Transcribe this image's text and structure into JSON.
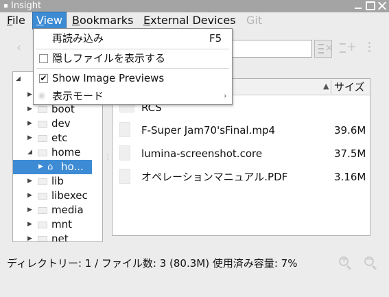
{
  "window": {
    "title": "Insight",
    "controls": {
      "minimize_icon": "minimize-icon",
      "maximize_icon": "maximize-icon",
      "close_icon": "close-icon"
    }
  },
  "menubar": {
    "file": {
      "prefix": "",
      "mnemonic": "F",
      "rest": "ile"
    },
    "view": {
      "prefix": "",
      "mnemonic": "V",
      "rest": "iew"
    },
    "bookmarks": {
      "prefix": "",
      "mnemonic": "B",
      "rest": "ookmarks"
    },
    "external": {
      "prefix": "",
      "mnemonic": "E",
      "rest": "xternal Devices"
    },
    "git": {
      "label": "Git"
    }
  },
  "view_menu": {
    "reload": {
      "label": "再読み込み",
      "shortcut": "F5"
    },
    "show_hidden": {
      "label": "隠しファイルを表示する",
      "checked": false
    },
    "show_previews": {
      "label": "Show Image Previews",
      "checked": true,
      "check_glyph": "✔"
    },
    "view_mode": {
      "label": "表示モード",
      "submenu_glyph": "›"
    }
  },
  "tree": {
    "expand_glyph": "▶",
    "collapse_glyph": "◢",
    "items": [
      {
        "label": ""
      },
      {
        "label": ""
      },
      {
        "label": "boot"
      },
      {
        "label": "dev"
      },
      {
        "label": "etc"
      },
      {
        "label": "home"
      },
      {
        "label": "ho..."
      },
      {
        "label": "lib"
      },
      {
        "label": "libexec"
      },
      {
        "label": "media"
      },
      {
        "label": "mnt"
      },
      {
        "label": "net"
      }
    ]
  },
  "file_list": {
    "size_header": "サイズ",
    "sort_glyph": "▲",
    "rows": [
      {
        "name": "RCS",
        "size": ""
      },
      {
        "name": "F-Super Jam70'sFinal.mp4",
        "size": "39.6M"
      },
      {
        "name": "lumina-screenshot.core",
        "size": "37.5M"
      },
      {
        "name": "オペレーションマニュアル.PDF",
        "size": "3.16M"
      }
    ]
  },
  "status": {
    "text": "ディレクトリー: 1 / ファイル数: 3 (80.3M) 使用済み容量: 7%"
  },
  "toolbar": {
    "back_glyph": "‹",
    "address_value": ""
  },
  "colors": {
    "accent": "#3d8bd4",
    "titlebar": "#a4a4a4",
    "background": "#ececec"
  }
}
